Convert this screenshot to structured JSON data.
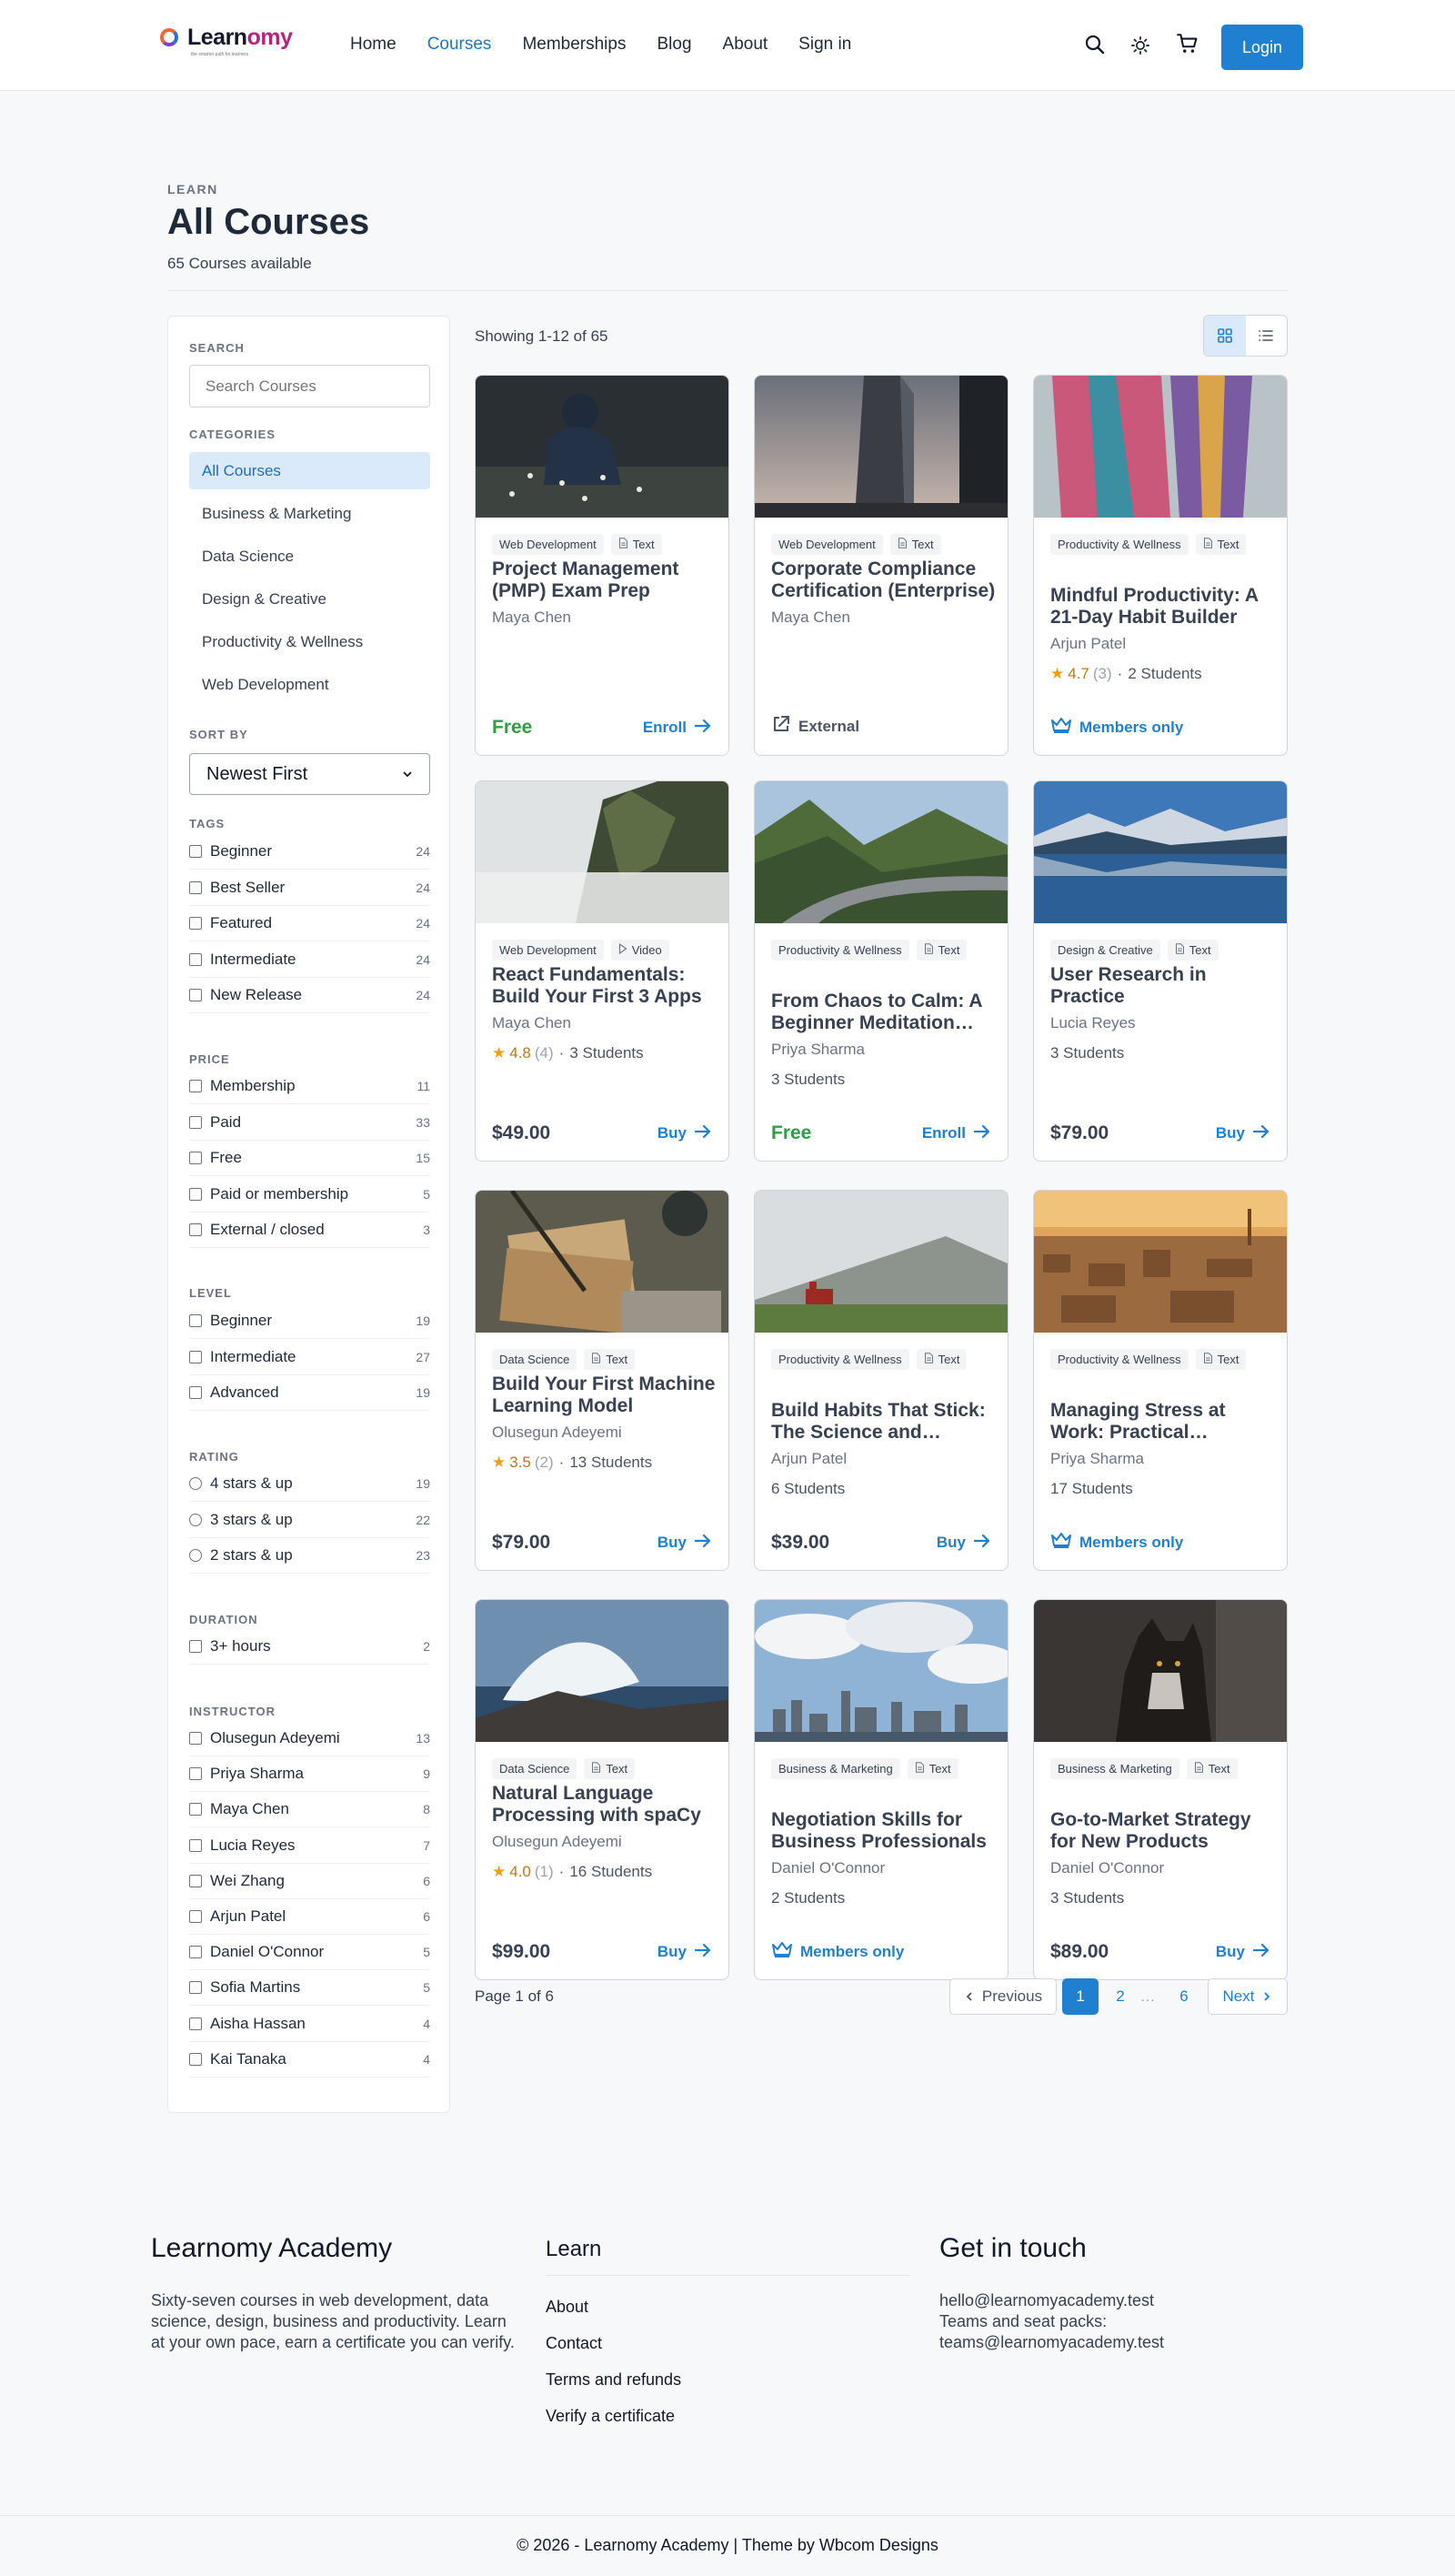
{
  "header": {
    "logo": {
      "name_main": "Learn",
      "name_accent": "omy",
      "tagline": "the smarter path for learners"
    },
    "nav": [
      "Home",
      "Courses",
      "Memberships",
      "Blog",
      "About",
      "Sign in"
    ],
    "active_nav": "Courses",
    "icons": [
      "search-icon",
      "sun-icon",
      "cart-icon"
    ],
    "login_label": "Login"
  },
  "page": {
    "eyebrow": "LEARN",
    "title": "All Courses",
    "subtitle": "65 Courses available"
  },
  "sidebar": {
    "search_label": "SEARCH",
    "search_placeholder": "Search Courses",
    "categories_label": "CATEGORIES",
    "categories": [
      "All Courses",
      "Business & Marketing",
      "Data Science",
      "Design & Creative",
      "Productivity & Wellness",
      "Web Development"
    ],
    "sort_label": "SORT BY",
    "sort_value": "Newest First",
    "tags_label": "TAGS",
    "tags": [
      {
        "label": "Beginner",
        "count": "24"
      },
      {
        "label": "Best Seller",
        "count": "24"
      },
      {
        "label": "Featured",
        "count": "24"
      },
      {
        "label": "Intermediate",
        "count": "24"
      },
      {
        "label": "New Release",
        "count": "24"
      }
    ],
    "price_label": "PRICE",
    "price": [
      {
        "label": "Membership",
        "count": "11"
      },
      {
        "label": "Paid",
        "count": "33"
      },
      {
        "label": "Free",
        "count": "15"
      },
      {
        "label": "Paid or membership",
        "count": "5"
      },
      {
        "label": "External / closed",
        "count": "3"
      }
    ],
    "level_label": "LEVEL",
    "level": [
      {
        "label": "Beginner",
        "count": "19"
      },
      {
        "label": "Intermediate",
        "count": "27"
      },
      {
        "label": "Advanced",
        "count": "19"
      }
    ],
    "rating_label": "RATING",
    "rating": [
      {
        "label": "4 stars & up",
        "count": "19"
      },
      {
        "label": "3 stars & up",
        "count": "22"
      },
      {
        "label": "2 stars & up",
        "count": "23"
      }
    ],
    "duration_label": "DURATION",
    "duration": [
      {
        "label": "3+ hours",
        "count": "2"
      }
    ],
    "instructor_label": "INSTRUCTOR",
    "instructors": [
      {
        "label": "Olusegun Adeyemi",
        "count": "13"
      },
      {
        "label": "Priya Sharma",
        "count": "9"
      },
      {
        "label": "Maya Chen",
        "count": "8"
      },
      {
        "label": "Lucia Reyes",
        "count": "7"
      },
      {
        "label": "Wei Zhang",
        "count": "6"
      },
      {
        "label": "Arjun Patel",
        "count": "6"
      },
      {
        "label": "Daniel O'Connor",
        "count": "5"
      },
      {
        "label": "Sofia Martins",
        "count": "5"
      },
      {
        "label": "Aisha Hassan",
        "count": "4"
      },
      {
        "label": "Kai Tanaka",
        "count": "4"
      }
    ]
  },
  "results": {
    "showing": "Showing 1-12 of 65",
    "view_icons": [
      "grid-view-icon",
      "list-view-icon"
    ]
  },
  "courses": [
    {
      "category": "Web Development",
      "format": "Text",
      "title": "Project Management (PMP) Exam Prep",
      "author": "Maya Chen",
      "rating": "",
      "reviews": "",
      "students": "",
      "price": "Free",
      "action": "Enroll",
      "thumb_icon": "person-in-field-photo"
    },
    {
      "category": "Web Development",
      "format": "Text",
      "title": "Corporate Compliance Certification (Enterprise)",
      "author": "Maya Chen",
      "rating": "",
      "reviews": "",
      "students": "",
      "price": "",
      "action": "External",
      "thumb_icon": "skyscraper-photo"
    },
    {
      "category": "Productivity & Wellness",
      "format": "Text",
      "title": "Mindful Productivity: A 21-Day Habit Builder",
      "author": "Arjun Patel",
      "rating": "4.7",
      "reviews": "(3)",
      "students": "2 Students",
      "price": "",
      "action": "Members only",
      "thumb_icon": "textile-photo"
    },
    {
      "category": "Web Development",
      "format": "Video",
      "title": "React Fundamentals: Build Your First 3 Apps",
      "author": "Maya Chen",
      "rating": "4.8",
      "reviews": "(4)",
      "students": "3 Students",
      "price": "$49.00",
      "action": "Buy",
      "thumb_icon": "misty-cliff-photo"
    },
    {
      "category": "Productivity & Wellness",
      "format": "Text",
      "title": "From Chaos to Calm: A Beginner Meditation…",
      "author": "Priya Sharma",
      "rating": "",
      "reviews": "",
      "students": "3 Students",
      "price": "Free",
      "action": "Enroll",
      "thumb_icon": "mountain-road-photo"
    },
    {
      "category": "Design & Creative",
      "format": "Text",
      "title": "User Research in Practice",
      "author": "Lucia Reyes",
      "rating": "",
      "reviews": "",
      "students": "3 Students",
      "price": "$79.00",
      "action": "Buy",
      "thumb_icon": "mountain-lake-photo"
    },
    {
      "category": "Data Science",
      "format": "Text",
      "title": "Build Your First Machine Learning Model",
      "author": "Olusegun Adeyemi",
      "rating": "3.5",
      "reviews": "(2)",
      "students": "13 Students",
      "price": "$79.00",
      "action": "Buy",
      "thumb_icon": "vintage-papers-photo"
    },
    {
      "category": "Productivity & Wellness",
      "format": "Text",
      "title": "Build Habits That Stick: The Science and…",
      "author": "Arjun Patel",
      "rating": "",
      "reviews": "",
      "students": "6 Students",
      "price": "$39.00",
      "action": "Buy",
      "thumb_icon": "church-hills-photo"
    },
    {
      "category": "Productivity & Wellness",
      "format": "Text",
      "title": "Managing Stress at Work: Practical…",
      "author": "Priya Sharma",
      "rating": "",
      "reviews": "",
      "students": "17 Students",
      "price": "",
      "action": "Members only",
      "thumb_icon": "city-sunset-photo"
    },
    {
      "category": "Data Science",
      "format": "Text",
      "title": "Natural Language Processing with spaCy",
      "author": "Olusegun Adeyemi",
      "rating": "4.0",
      "reviews": "(1)",
      "students": "16 Students",
      "price": "$99.00",
      "action": "Buy",
      "thumb_icon": "wave-rocks-photo"
    },
    {
      "category": "Business & Marketing",
      "format": "Text",
      "title": "Negotiation Skills for Business Professionals",
      "author": "Daniel O'Connor",
      "rating": "",
      "reviews": "",
      "students": "2 Students",
      "price": "",
      "action": "Members only",
      "thumb_icon": "skyline-clouds-photo"
    },
    {
      "category": "Business & Marketing",
      "format": "Text",
      "title": "Go-to-Market Strategy for New Products",
      "author": "Daniel O'Connor",
      "rating": "",
      "reviews": "",
      "students": "3 Students",
      "price": "$89.00",
      "action": "Buy",
      "thumb_icon": "husky-dog-photo"
    }
  ],
  "pagination": {
    "info": "Page 1 of 6",
    "previous": "Previous",
    "pages": [
      "1",
      "2",
      "…",
      "6"
    ],
    "current": "1",
    "next": "Next"
  },
  "footer": {
    "brand_title": "Learnomy Academy",
    "brand_text": "Sixty-seven courses in web development, data science, design, business and productivity. Learn at your own pace, earn a certificate you can verify.",
    "learn_title": "Learn",
    "learn_links": [
      "About",
      "Contact",
      "Terms and refunds",
      "Verify a certificate"
    ],
    "contact_title": "Get in touch",
    "contact_email": "hello@learnomyacademy.test",
    "contact_teams_label": "Teams and seat packs:",
    "contact_teams_email": "teams@learnomyacademy.test",
    "copyright": "© 2026 - Learnomy Academy | Theme by Wbcom Designs"
  },
  "colors": {
    "accent": "#1f7fd0",
    "free": "#2f9e44",
    "star": "#f59e0b",
    "active_category_bg": "#dbeafb"
  }
}
